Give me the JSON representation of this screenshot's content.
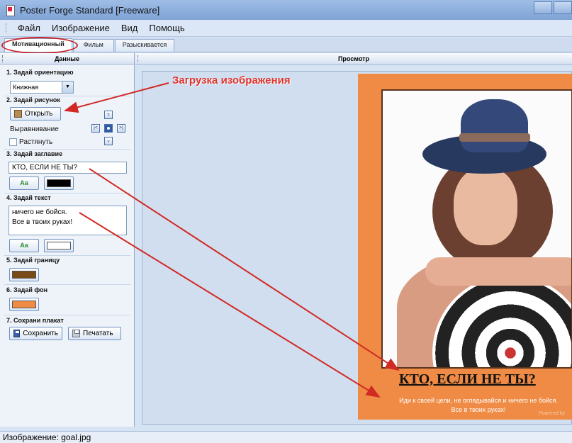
{
  "window": {
    "title": "Poster Forge Standard [Freeware]"
  },
  "menu": [
    "Файл",
    "Изображение",
    "Вид",
    "Помощь"
  ],
  "tabs": [
    "Мотивационный",
    "Фильм",
    "Разыскивается"
  ],
  "left_panel": {
    "header": "Данные",
    "s1": "1. Задай ориентацию",
    "orientation_value": "Книжная",
    "s2": "2. Задай рисунок",
    "open_label": "Открыть",
    "align_label": "Выравнивание",
    "stretch_label": "Растянуть",
    "s3": "3. Задай заглавие",
    "title_value": "КТО, ЕСЛИ НЕ ТЫ?",
    "s4": "4. Задай текст",
    "text_line1": "ничего не бойся.",
    "text_line2": "Все в твоих руках!",
    "s5": "5. Задай границу",
    "s6": "6. Задай фон",
    "s7": "7. Сохрани плакат",
    "save_label": "Сохранить",
    "print_label": "Печатать",
    "font_btn_label": "Aa",
    "title_color": "#000000",
    "text_color": "#ffffff",
    "border_color": "#7a4a16",
    "background_color": "#ef8b45"
  },
  "preview": {
    "header": "Просмотр",
    "poster_title": "КТО, ЕСЛИ НЕ ТЫ?",
    "poster_line1": "Иди к своей цели, не оглядывайся и ничего не бойся.",
    "poster_line2": "Все в твоих руках!",
    "credit": "Powered by"
  },
  "annotation": "Загрузка изображения",
  "status": "Изображение: goal.jpg"
}
